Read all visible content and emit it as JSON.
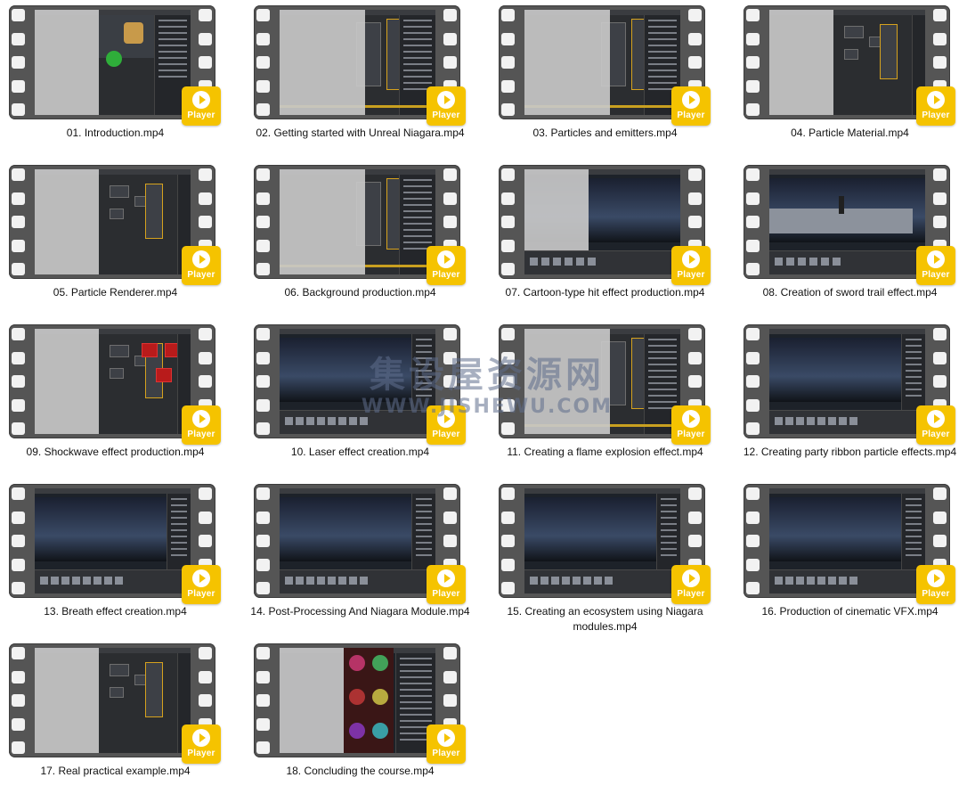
{
  "player_label": "Player",
  "watermark": {
    "cn": "集设屋资源网",
    "en": "WWW.JISHEWU.COM"
  },
  "videos": [
    {
      "title": "01. Introduction.mp4",
      "thumb": "viewport-chair"
    },
    {
      "title": "02. Getting started with Unreal Niagara.mp4",
      "thumb": "editor-panels"
    },
    {
      "title": "03. Particles and emitters.mp4",
      "thumb": "editor-panels"
    },
    {
      "title": "04. Particle Material.mp4",
      "thumb": "node-graph"
    },
    {
      "title": "05. Particle Renderer.mp4",
      "thumb": "node-graph"
    },
    {
      "title": "06. Background production.mp4",
      "thumb": "editor-panels"
    },
    {
      "title": "07. Cartoon-type hit effect production.mp4",
      "thumb": "viewport-dark"
    },
    {
      "title": "08. Creation of sword trail effect.mp4",
      "thumb": "viewport-character"
    },
    {
      "title": "09. Shockwave effect production.mp4",
      "thumb": "node-graph-red"
    },
    {
      "title": "10. Laser effect creation.mp4",
      "thumb": "viewport-timeline"
    },
    {
      "title": "11. Creating a flame explosion effect.mp4",
      "thumb": "editor-panels"
    },
    {
      "title": "12. Creating party ribbon particle effects.mp4",
      "thumb": "viewport-timeline"
    },
    {
      "title": "13. Breath effect creation.mp4",
      "thumb": "viewport-timeline"
    },
    {
      "title": "14. Post-Processing And Niagara Module.mp4",
      "thumb": "viewport-timeline"
    },
    {
      "title": "15. Creating an ecosystem using Niagara modules.mp4",
      "thumb": "viewport-timeline"
    },
    {
      "title": "16. Production of cinematic VFX.mp4",
      "thumb": "viewport-timeline"
    },
    {
      "title": "17. Real practical example.mp4",
      "thumb": "node-graph"
    },
    {
      "title": "18. Concluding the course.mp4",
      "thumb": "effects-gallery"
    }
  ]
}
